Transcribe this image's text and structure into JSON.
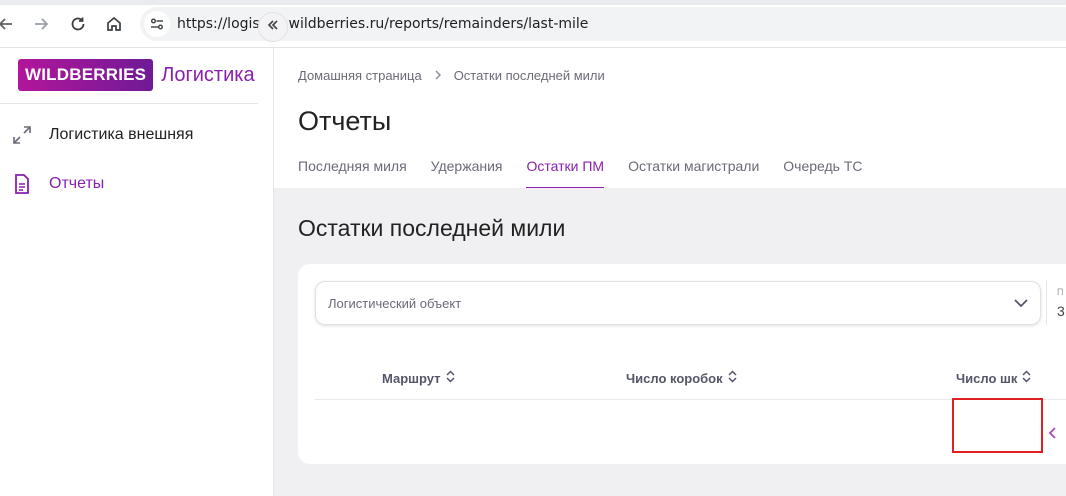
{
  "browser": {
    "url": "https://logistics.wildberries.ru/reports/remainders/last-mile"
  },
  "sidebar": {
    "logo_brand": "WILDBERRIES",
    "logo_sub": "Логистика",
    "items": [
      {
        "label": "Логистика внешняя",
        "icon": "expand-arrows-icon"
      },
      {
        "label": "Отчеты",
        "icon": "document-icon"
      }
    ]
  },
  "header": {
    "breadcrumb": [
      "Домашняя страница",
      "Остатки последней мили"
    ],
    "title": "Отчеты",
    "tabs": [
      {
        "label": "Последняя миля",
        "active": false
      },
      {
        "label": "Удержания",
        "active": false
      },
      {
        "label": "Остатки ПМ",
        "active": true
      },
      {
        "label": "Остатки магистрали",
        "active": false
      },
      {
        "label": "Очередь ТС",
        "active": false
      }
    ]
  },
  "report": {
    "title": "Остатки последней мили",
    "filter_placeholder": "Логистический объект",
    "extra_field_label": "П",
    "extra_field_value": "3",
    "columns": [
      "Маршрут",
      "Число коробок",
      "Число шк"
    ]
  },
  "colors": {
    "accent": "#8a1fb0",
    "highlight": "#e02020"
  }
}
